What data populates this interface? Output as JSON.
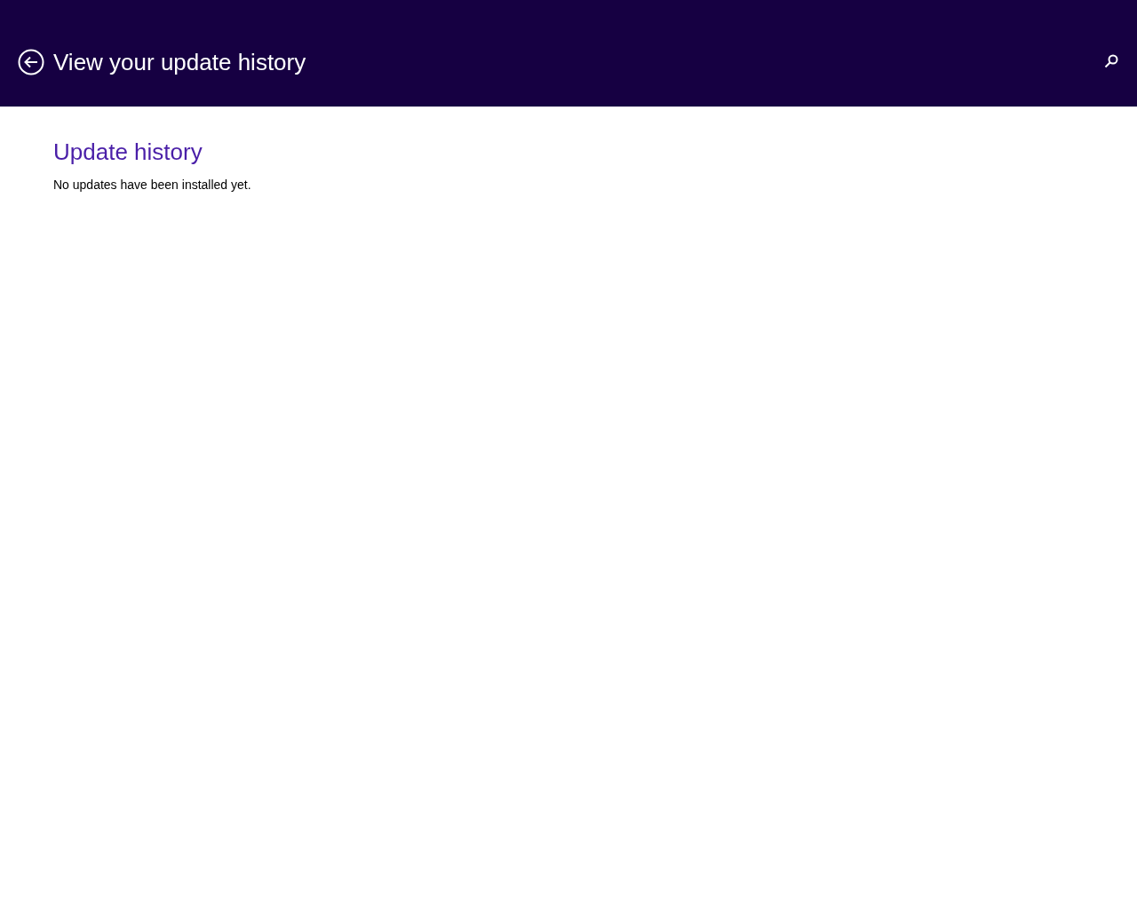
{
  "header": {
    "title": "View your update history"
  },
  "section": {
    "heading": "Update history",
    "message": "No updates have been installed yet."
  }
}
